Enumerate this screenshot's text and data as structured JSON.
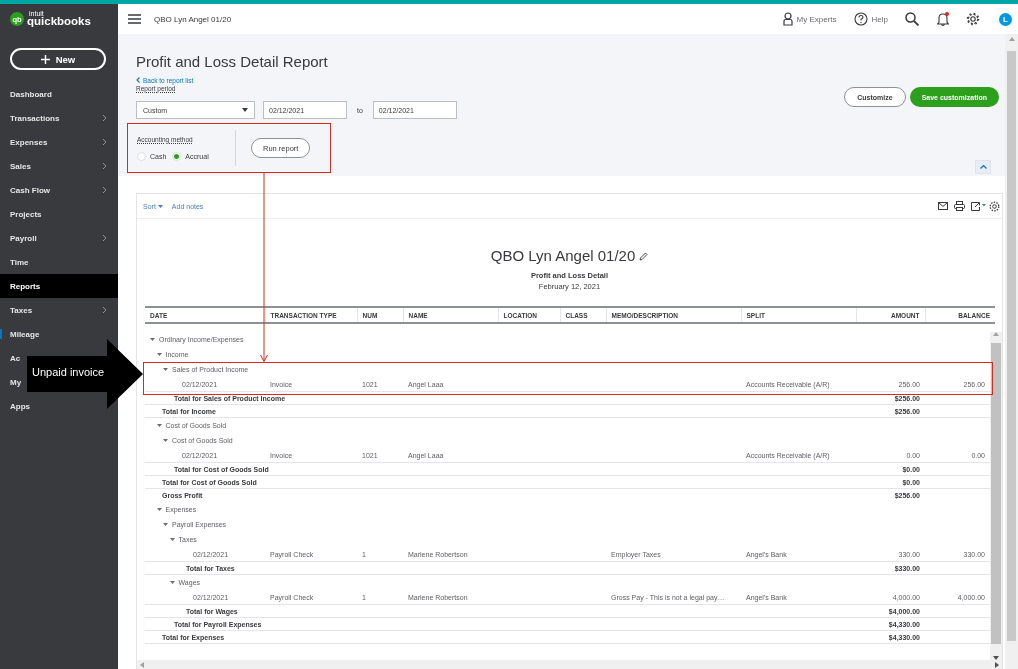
{
  "sidebar": {
    "logo_mark": "qb",
    "logo_small": "intuit",
    "logo": "quickbooks",
    "new_button": "New",
    "items": [
      {
        "label": "Dashboard",
        "submenu": false,
        "selected": false,
        "flagged": false
      },
      {
        "label": "Transactions",
        "submenu": true,
        "selected": false,
        "flagged": false
      },
      {
        "label": "Expenses",
        "submenu": true,
        "selected": false,
        "flagged": false
      },
      {
        "label": "Sales",
        "submenu": true,
        "selected": false,
        "flagged": false
      },
      {
        "label": "Cash Flow",
        "submenu": true,
        "selected": false,
        "flagged": false
      },
      {
        "label": "Projects",
        "submenu": false,
        "selected": false,
        "flagged": false
      },
      {
        "label": "Payroll",
        "submenu": true,
        "selected": false,
        "flagged": false
      },
      {
        "label": "Time",
        "submenu": false,
        "selected": false,
        "flagged": false
      },
      {
        "label": "Reports",
        "submenu": false,
        "selected": true,
        "flagged": false
      },
      {
        "label": "Taxes",
        "submenu": true,
        "selected": false,
        "flagged": false
      },
      {
        "label": "Mileage",
        "submenu": false,
        "selected": false,
        "flagged": true
      },
      {
        "label": "Ac",
        "submenu": false,
        "selected": false,
        "flagged": false
      },
      {
        "label": "My",
        "submenu": false,
        "selected": false,
        "flagged": false
      },
      {
        "label": "Apps",
        "submenu": false,
        "selected": false,
        "flagged": false
      }
    ]
  },
  "header": {
    "company": "QBO Lyn Angel 01/20",
    "actions": [
      {
        "kind": "experts",
        "label": "My Experts"
      },
      {
        "kind": "help",
        "label": "Help"
      },
      {
        "kind": "search"
      },
      {
        "kind": "bell",
        "alert": true
      },
      {
        "kind": "settings"
      },
      {
        "kind": "avatar",
        "label": "L"
      }
    ]
  },
  "controls": {
    "title": "Profit and Loss Detail Report",
    "back_link": "Back to report list",
    "period_label": "Report period",
    "period": "Custom",
    "from": "02/12/2021",
    "to_label": "to",
    "to": "02/12/2021",
    "method": {
      "label": "Accounting method",
      "highlighted": true,
      "options": [
        {
          "label": "Cash",
          "selected": false
        },
        {
          "label": "Accrual",
          "selected": true
        }
      ]
    },
    "run_button": "Run report",
    "customize_button": "Customize",
    "save_button": "Save customization"
  },
  "report": {
    "sort": "Sort",
    "add_notes": "Add notes",
    "company": "QBO Lyn Angel 01/20",
    "title": "Profit and Loss Detail",
    "date": "February 12, 2021",
    "columns": [
      "DATE",
      "TRANSACTION TYPE",
      "NUM",
      "NAME",
      "LOCATION",
      "CLASS",
      "MEMO/DESCRIPTION",
      "SPLIT",
      "AMOUNT",
      "BALANCE"
    ],
    "rows": [
      {
        "kind": "group",
        "label": "Ordinary Income/Expenses",
        "expanded": true,
        "children": [
          {
            "kind": "group",
            "label": "Income",
            "expanded": true,
            "children": [
              {
                "kind": "group",
                "label": "Sales of Product Income",
                "expanded": true,
                "highlighted": true,
                "children": [
                  {
                    "kind": "txn",
                    "highlighted": true,
                    "date": "02/12/2021",
                    "type": "Invoice",
                    "num": "1021",
                    "name": "Angel Laaa",
                    "split": "Accounts Receivable (A/R)",
                    "amount": "256.00",
                    "balance": "256.00"
                  }
                ],
                "total": {
                  "label": "Total for Sales of Product Income",
                  "amount": "$256.00"
                }
              }
            ],
            "total": {
              "label": "Total for Income",
              "amount": "$256.00"
            }
          },
          {
            "kind": "group",
            "label": "Cost of Goods Sold",
            "expanded": true,
            "children": [
              {
                "kind": "group",
                "label": "Cost of Goods Sold",
                "expanded": true,
                "children": [
                  {
                    "kind": "txn",
                    "date": "02/12/2021",
                    "type": "Invoice",
                    "num": "1021",
                    "name": "Angel Laaa",
                    "split": "Accounts Receivable (A/R)",
                    "amount": "0.00",
                    "balance": "0.00"
                  }
                ],
                "total": {
                  "label": "Total for Cost of Goods Sold",
                  "amount": "$0.00"
                }
              }
            ],
            "total": {
              "label": "Total for Cost of Goods Sold",
              "amount": "$0.00"
            }
          },
          {
            "kind": "summary",
            "label": "Gross Profit",
            "amount": "$256.00"
          },
          {
            "kind": "group",
            "label": "Expenses",
            "expanded": true,
            "children": [
              {
                "kind": "group",
                "label": "Payroll Expenses",
                "expanded": true,
                "children": [
                  {
                    "kind": "group",
                    "label": "Taxes",
                    "expanded": true,
                    "children": [
                      {
                        "kind": "txn",
                        "date": "02/12/2021",
                        "type": "Payroll Check",
                        "num": "1",
                        "name": "Marlene Robertson",
                        "memo": "Employer Taxes",
                        "split": "Angel's Bank",
                        "amount": "330.00",
                        "balance": "330.00"
                      }
                    ],
                    "total": {
                      "label": "Total for Taxes",
                      "amount": "$330.00"
                    }
                  },
                  {
                    "kind": "group",
                    "label": "Wages",
                    "expanded": true,
                    "children": [
                      {
                        "kind": "txn",
                        "date": "02/12/2021",
                        "type": "Payroll Check",
                        "num": "1",
                        "name": "Marlene Robertson",
                        "memo": "Gross Pay - This is not a legal pay…",
                        "split": "Angel's Bank",
                        "amount": "4,000.00",
                        "balance": "4,000.00"
                      }
                    ],
                    "total": {
                      "label": "Total for Wages",
                      "amount": "$4,000.00"
                    }
                  }
                ],
                "total": {
                  "label": "Total for Payroll Expenses",
                  "amount": "$4,330.00"
                }
              }
            ],
            "total": {
              "label": "Total for Expenses",
              "amount": "$4,330.00"
            }
          }
        ]
      }
    ]
  },
  "callout": {
    "label": "Unpaid invoice"
  }
}
